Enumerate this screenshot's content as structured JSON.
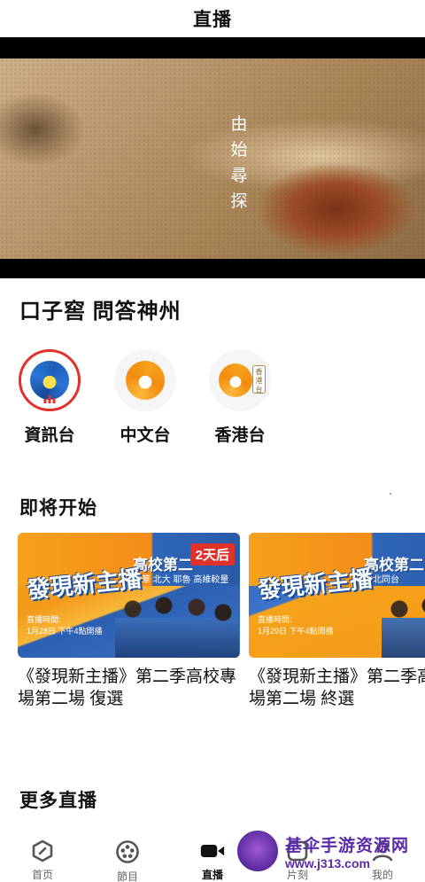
{
  "header": {
    "title": "直播"
  },
  "player": {
    "overlay_text": "由始尋探"
  },
  "program": {
    "title": "口子窖 問答神州"
  },
  "channels": [
    {
      "name": "資訊台",
      "selected": true
    },
    {
      "name": "中文台",
      "selected": false
    },
    {
      "name": "香港台",
      "selected": false,
      "tag": "香港台"
    }
  ],
  "upcoming": {
    "section_title": "即将开始",
    "cards": [
      {
        "thumb_show": "發現新主播",
        "thumb_subtitle": "高校第二",
        "thumb_small": "清華 北大 耶魯 高維較量",
        "thumb_airtime": "直播時間:\n1月28日 下午4點開播",
        "badge": "2天后",
        "title": "《發現新主播》第二季高校專場第二場 復選"
      },
      {
        "thumb_show": "發現新主播",
        "thumb_subtitle": "高校第二",
        "thumb_small": "清北同台",
        "thumb_airtime": "直播時間:\n1月29日 下午4點開播",
        "badge": "",
        "title": "《發現新主播》第二季高校專場第二場 終選"
      }
    ]
  },
  "more": {
    "section_title": "更多直播"
  },
  "tabbar": {
    "items": [
      {
        "label": "首页",
        "icon": "home-icon"
      },
      {
        "label": "節目",
        "icon": "film-reel-icon"
      },
      {
        "label": "直播",
        "icon": "video-camera-icon",
        "active": true
      },
      {
        "label": "片刻",
        "icon": "clip-icon"
      },
      {
        "label": "我的",
        "icon": "profile-icon"
      }
    ]
  },
  "watermark": {
    "line1": "基伞手游资源网",
    "line2": "www.j313.com"
  },
  "colors": {
    "accent": "#e1312b",
    "phoenix_orange": "#f28c0f",
    "phoenix_blue": "#1f5db8"
  }
}
